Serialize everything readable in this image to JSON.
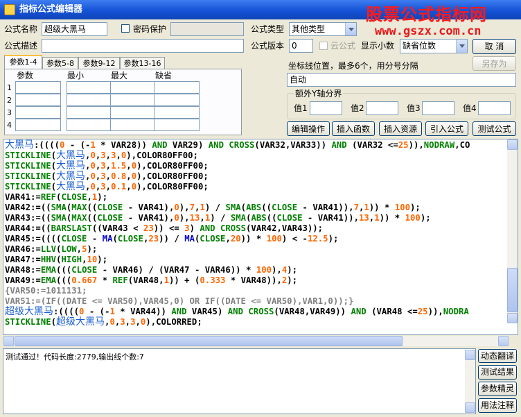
{
  "window": {
    "title": "指标公式编辑器"
  },
  "watermark": {
    "line1": "股票公式指标网",
    "line2": "www.gszx.com.cn"
  },
  "form": {
    "name_label": "公式名称",
    "name_value": "超级大黑马",
    "password_label": "密码保护",
    "type_label": "公式类型",
    "type_value": "其他类型",
    "desc_label": "公式描述",
    "desc_value": "",
    "version_label": "公式版本",
    "version_value": "0",
    "cloud_label": "云公式",
    "decimals_label": "显示小数",
    "decimals_value": "缺省位数"
  },
  "buttons": {
    "cancel": "取 消",
    "save_as": "另存为",
    "edit_ops": "编辑操作",
    "insert_func": "插入函数",
    "insert_res": "插入资源",
    "import_formula": "引入公式",
    "test_formula": "测试公式",
    "side": [
      "动态翻译",
      "测试结果",
      "参数精灵",
      "用法注释"
    ]
  },
  "tabs": [
    "参数1-4",
    "参数5-8",
    "参数9-12",
    "参数13-16"
  ],
  "param_table": {
    "headers": [
      "参数",
      "最小",
      "最大",
      "缺省"
    ],
    "rows": [
      "1",
      "2",
      "3",
      "4"
    ]
  },
  "axis": {
    "label": "坐标线位置，最多6个，用分号分隔",
    "value": "自动",
    "group_label": "额外Y轴分界",
    "values": [
      "值1",
      "值2",
      "值3",
      "值4"
    ]
  },
  "code_lines": [
    [
      [
        "id",
        "大黑马"
      ],
      [
        "sym",
        ":(((("
      ],
      [
        "num",
        "0"
      ],
      [
        "sym",
        " - (-"
      ],
      [
        "num",
        "1"
      ],
      [
        "sym",
        " * VAR28)) "
      ],
      [
        "kw",
        "AND"
      ],
      [
        "sym",
        " VAR29) "
      ],
      [
        "kw",
        "AND"
      ],
      [
        "sym",
        " "
      ],
      [
        "fn",
        "CROSS"
      ],
      [
        "sym",
        "(VAR32,VAR33)) "
      ],
      [
        "kw",
        "AND"
      ],
      [
        "sym",
        " (VAR32 <="
      ],
      [
        "num",
        "25"
      ],
      [
        "sym",
        ")),"
      ],
      [
        "fn",
        "NODRAW"
      ],
      [
        "sym",
        ",CO"
      ]
    ],
    [
      [
        "fn",
        "STICKLINE"
      ],
      [
        "sym",
        "("
      ],
      [
        "id",
        "大黑马"
      ],
      [
        "sym",
        ","
      ],
      [
        "num",
        "0"
      ],
      [
        "sym",
        ","
      ],
      [
        "num",
        "3"
      ],
      [
        "sym",
        ","
      ],
      [
        "num",
        "3"
      ],
      [
        "sym",
        ","
      ],
      [
        "num",
        "0"
      ],
      [
        "sym",
        "),COLOR80FF00;"
      ]
    ],
    [
      [
        "fn",
        "STICKLINE"
      ],
      [
        "sym",
        "("
      ],
      [
        "id",
        "大黑马"
      ],
      [
        "sym",
        ","
      ],
      [
        "num",
        "0"
      ],
      [
        "sym",
        ","
      ],
      [
        "num",
        "3"
      ],
      [
        "sym",
        ","
      ],
      [
        "num",
        "1.5"
      ],
      [
        "sym",
        ","
      ],
      [
        "num",
        "0"
      ],
      [
        "sym",
        "),COLOR80FF00;"
      ]
    ],
    [
      [
        "fn",
        "STICKLINE"
      ],
      [
        "sym",
        "("
      ],
      [
        "id",
        "大黑马"
      ],
      [
        "sym",
        ","
      ],
      [
        "num",
        "0"
      ],
      [
        "sym",
        ","
      ],
      [
        "num",
        "3"
      ],
      [
        "sym",
        ","
      ],
      [
        "num",
        "0.8"
      ],
      [
        "sym",
        ","
      ],
      [
        "num",
        "0"
      ],
      [
        "sym",
        "),COLOR80FF00;"
      ]
    ],
    [
      [
        "fn",
        "STICKLINE"
      ],
      [
        "sym",
        "("
      ],
      [
        "id",
        "大黑马"
      ],
      [
        "sym",
        ","
      ],
      [
        "num",
        "0"
      ],
      [
        "sym",
        ","
      ],
      [
        "num",
        "3"
      ],
      [
        "sym",
        ","
      ],
      [
        "num",
        "0.1"
      ],
      [
        "sym",
        ","
      ],
      [
        "num",
        "0"
      ],
      [
        "sym",
        "),COLOR80FF00;"
      ]
    ],
    [
      [
        "sym",
        "VAR41:="
      ],
      [
        "fn",
        "REF"
      ],
      [
        "sym",
        "("
      ],
      [
        "fn",
        "CLOSE"
      ],
      [
        "sym",
        ","
      ],
      [
        "num",
        "1"
      ],
      [
        "sym",
        ");"
      ]
    ],
    [
      [
        "sym",
        "VAR42:=(("
      ],
      [
        "fn",
        "SMA"
      ],
      [
        "sym",
        "("
      ],
      [
        "fn",
        "MAX"
      ],
      [
        "sym",
        "(("
      ],
      [
        "fn",
        "CLOSE"
      ],
      [
        "sym",
        " - VAR41),"
      ],
      [
        "num",
        "0"
      ],
      [
        "sym",
        "),"
      ],
      [
        "num",
        "7"
      ],
      [
        "sym",
        ","
      ],
      [
        "num",
        "1"
      ],
      [
        "sym",
        ") / "
      ],
      [
        "fn",
        "SMA"
      ],
      [
        "sym",
        "("
      ],
      [
        "fn",
        "ABS"
      ],
      [
        "sym",
        "(("
      ],
      [
        "fn",
        "CLOSE"
      ],
      [
        "sym",
        " - VAR41)),"
      ],
      [
        "num",
        "7"
      ],
      [
        "sym",
        ","
      ],
      [
        "num",
        "1"
      ],
      [
        "sym",
        ")) * "
      ],
      [
        "num",
        "100"
      ],
      [
        "sym",
        ");"
      ]
    ],
    [
      [
        "sym",
        "VAR43:=(("
      ],
      [
        "fn",
        "SMA"
      ],
      [
        "sym",
        "("
      ],
      [
        "fn",
        "MAX"
      ],
      [
        "sym",
        "(("
      ],
      [
        "fn",
        "CLOSE"
      ],
      [
        "sym",
        " - VAR41),"
      ],
      [
        "num",
        "0"
      ],
      [
        "sym",
        "),"
      ],
      [
        "num",
        "13"
      ],
      [
        "sym",
        ","
      ],
      [
        "num",
        "1"
      ],
      [
        "sym",
        ") / "
      ],
      [
        "fn",
        "SMA"
      ],
      [
        "sym",
        "("
      ],
      [
        "fn",
        "ABS"
      ],
      [
        "sym",
        "(("
      ],
      [
        "fn",
        "CLOSE"
      ],
      [
        "sym",
        " - VAR41)),"
      ],
      [
        "num",
        "13"
      ],
      [
        "sym",
        ","
      ],
      [
        "num",
        "1"
      ],
      [
        "sym",
        ")) * "
      ],
      [
        "num",
        "100"
      ],
      [
        "sym",
        ");"
      ]
    ],
    [
      [
        "sym",
        "VAR44:=(("
      ],
      [
        "fn",
        "BARSLAST"
      ],
      [
        "sym",
        "((VAR43 < "
      ],
      [
        "num",
        "23"
      ],
      [
        "sym",
        ")) <= "
      ],
      [
        "num",
        "3"
      ],
      [
        "sym",
        ") "
      ],
      [
        "kw",
        "AND"
      ],
      [
        "sym",
        " "
      ],
      [
        "fn",
        "CROSS"
      ],
      [
        "sym",
        "(VAR42,VAR43));"
      ]
    ],
    [
      [
        "sym",
        "VAR45:=(((("
      ],
      [
        "fn",
        "CLOSE"
      ],
      [
        "sym",
        " - "
      ],
      [
        "k",
        "MA"
      ],
      [
        "sym",
        "("
      ],
      [
        "fn",
        "CLOSE"
      ],
      [
        "sym",
        ","
      ],
      [
        "num",
        "23"
      ],
      [
        "sym",
        ")) / "
      ],
      [
        "k",
        "MA"
      ],
      [
        "sym",
        "("
      ],
      [
        "fn",
        "CLOSE"
      ],
      [
        "sym",
        ","
      ],
      [
        "num",
        "20"
      ],
      [
        "sym",
        ")) * "
      ],
      [
        "num",
        "100"
      ],
      [
        "sym",
        ") < -"
      ],
      [
        "num",
        "12.5"
      ],
      [
        "sym",
        ");"
      ]
    ],
    [
      [
        "sym",
        "VAR46:="
      ],
      [
        "fn",
        "LLV"
      ],
      [
        "sym",
        "("
      ],
      [
        "fn",
        "LOW"
      ],
      [
        "sym",
        ","
      ],
      [
        "num",
        "5"
      ],
      [
        "sym",
        ");"
      ]
    ],
    [
      [
        "sym",
        "VAR47:="
      ],
      [
        "fn",
        "HHV"
      ],
      [
        "sym",
        "("
      ],
      [
        "fn",
        "HIGH"
      ],
      [
        "sym",
        ","
      ],
      [
        "num",
        "10"
      ],
      [
        "sym",
        ");"
      ]
    ],
    [
      [
        "sym",
        "VAR48:="
      ],
      [
        "fn",
        "EMA"
      ],
      [
        "sym",
        "((("
      ],
      [
        "fn",
        "CLOSE"
      ],
      [
        "sym",
        " - VAR46) / (VAR47 - VAR46)) * "
      ],
      [
        "num",
        "100"
      ],
      [
        "sym",
        "),"
      ],
      [
        "num",
        "4"
      ],
      [
        "sym",
        ");"
      ]
    ],
    [
      [
        "sym",
        "VAR49:="
      ],
      [
        "fn",
        "EMA"
      ],
      [
        "sym",
        "((("
      ],
      [
        "num",
        "0.667"
      ],
      [
        "sym",
        " * "
      ],
      [
        "fn",
        "REF"
      ],
      [
        "sym",
        "(VAR48,"
      ],
      [
        "num",
        "1"
      ],
      [
        "sym",
        ")) + ("
      ],
      [
        "num",
        "0.333"
      ],
      [
        "sym",
        " * VAR48)),"
      ],
      [
        "num",
        "2"
      ],
      [
        "sym",
        ");"
      ]
    ],
    [
      [
        "cm",
        "{VAR50:=1011131;"
      ]
    ],
    [
      [
        "cm",
        "VAR51:=(IF((DATE <= VAR50),VAR45,0) OR IF((DATE <= VAR50),VAR1,0));}"
      ]
    ],
    [
      [
        "id",
        "超级大黑马"
      ],
      [
        "sym",
        ":(((("
      ],
      [
        "num",
        "0"
      ],
      [
        "sym",
        " - (-"
      ],
      [
        "num",
        "1"
      ],
      [
        "sym",
        " * VAR44)) "
      ],
      [
        "kw",
        "AND"
      ],
      [
        "sym",
        " VAR45) "
      ],
      [
        "kw",
        "AND"
      ],
      [
        "sym",
        " "
      ],
      [
        "fn",
        "CROSS"
      ],
      [
        "sym",
        "(VAR48,VAR49)) "
      ],
      [
        "kw",
        "AND"
      ],
      [
        "sym",
        " (VAR48 <="
      ],
      [
        "num",
        "25"
      ],
      [
        "sym",
        ")),"
      ],
      [
        "fn",
        "NODRA"
      ]
    ],
    [
      [
        "fn",
        "STICKLINE"
      ],
      [
        "sym",
        "("
      ],
      [
        "id",
        "超级大黑马"
      ],
      [
        "sym",
        ","
      ],
      [
        "num",
        "0"
      ],
      [
        "sym",
        ","
      ],
      [
        "num",
        "3"
      ],
      [
        "sym",
        ","
      ],
      [
        "num",
        "3"
      ],
      [
        "sym",
        ","
      ],
      [
        "num",
        "0"
      ],
      [
        "sym",
        "),COLORRED;"
      ]
    ]
  ],
  "output": {
    "text": "测试通过！代码长度:2779,输出线个数:7"
  },
  "colors": {
    "id": "#1a5fd0",
    "func": "#008000",
    "num": "#ff6600",
    "comment": "#808080",
    "title_bar": "#1552d6",
    "watermark": "#ff1a1a"
  }
}
